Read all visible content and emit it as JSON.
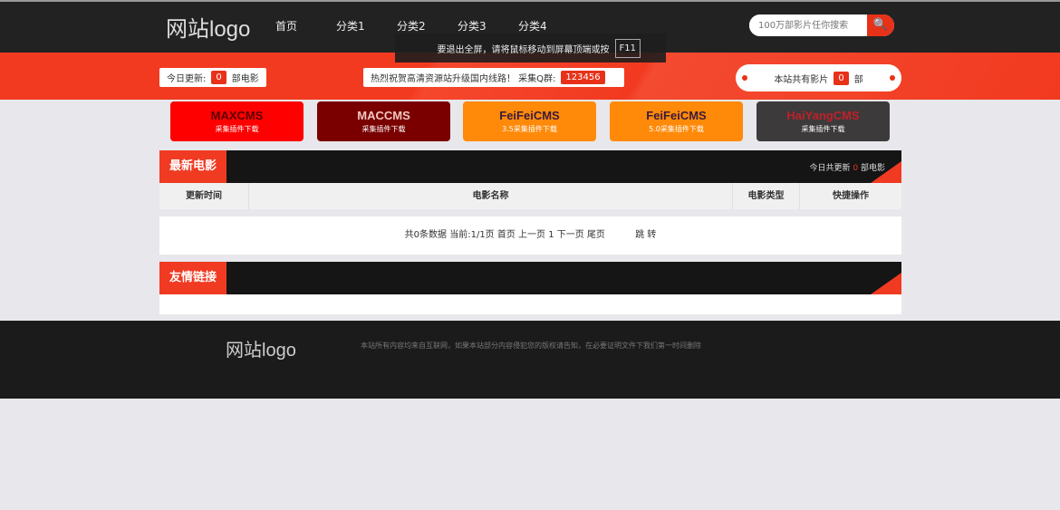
{
  "header": {
    "logo": "网站logo",
    "nav": [
      "首页",
      "分类1",
      "分类2",
      "分类3",
      "分类4"
    ],
    "search_placeholder": "100万部影片任你搜索",
    "search_icon": "🔍"
  },
  "fullscreen_notice": {
    "text": "要退出全屏，请将鼠标移动到屏幕顶端或按",
    "key": "F11"
  },
  "stats": {
    "today_label": "今日更新:",
    "today_count": "0",
    "today_unit": "部电影",
    "notice": "热烈祝贺高清资源站升级国内线路！ 采集Q群:",
    "qq": "123456",
    "total_label": "本站共有影片",
    "total_count": "0",
    "total_unit": "部"
  },
  "cms": [
    {
      "name": "MAXCMS",
      "sub": "采集插件下载",
      "bg": "#ff0000",
      "fg": "#5a0000"
    },
    {
      "name": "MACCMS",
      "sub": "采集插件下载",
      "bg": "#7a0000",
      "fg": "#f0c8c0"
    },
    {
      "name": "FeiFeiCMS",
      "sub": "3.5采集插件下载",
      "bg": "#ff8a0a",
      "fg": "#3a1a3a"
    },
    {
      "name": "FeiFeiCMS",
      "sub": "5.0采集插件下载",
      "bg": "#ff8a0a",
      "fg": "#3a1a3a"
    },
    {
      "name": "HaiYangCMS",
      "sub": "采集插件下载",
      "bg": "#3c3a3a",
      "fg": "#c0202a"
    }
  ],
  "latest": {
    "title": "最新电影",
    "right_prefix": "今日共更新",
    "right_count": "0",
    "right_suffix": "部电影",
    "columns": [
      "更新时间",
      "电影名称",
      "电影类型",
      "快捷操作"
    ],
    "pager": "共0条数据 当前:1/1页 首页 上一页 1 下一页 尾页",
    "jump": "跳 转"
  },
  "links": {
    "title": "友情链接"
  },
  "footer": {
    "logo": "网站logo",
    "text": "本站所有内容均来自互联网，如果本站部分内容侵犯您的版权请告知，在必要证明文件下我们第一时间删除"
  }
}
